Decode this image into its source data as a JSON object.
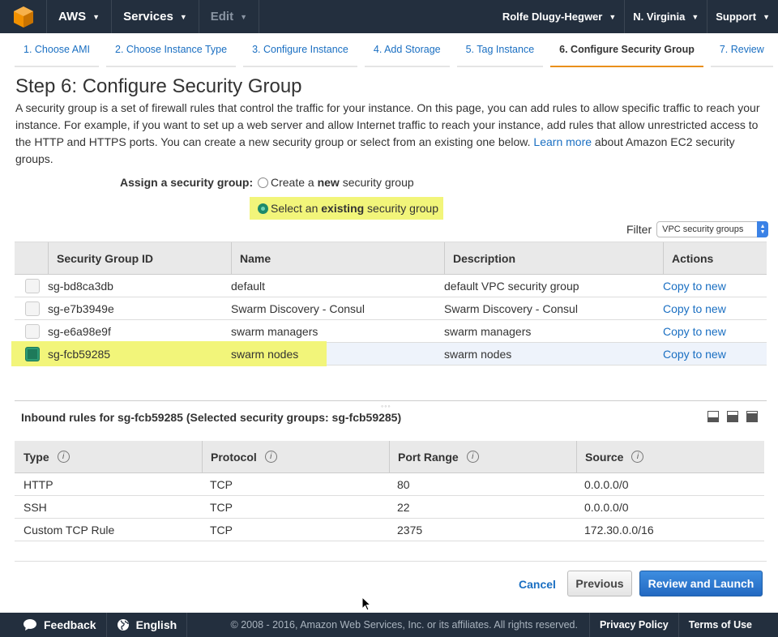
{
  "topnav": {
    "logo_icon": "aws-cube-icon",
    "aws_label": "AWS",
    "services_label": "Services",
    "edit_label": "Edit",
    "user_label": "Rolfe Dlugy-Hegwer",
    "region_label": "N. Virginia",
    "support_label": "Support"
  },
  "wizard": {
    "steps": [
      {
        "label": "1. Choose AMI"
      },
      {
        "label": "2. Choose Instance Type"
      },
      {
        "label": "3. Configure Instance"
      },
      {
        "label": "4. Add Storage"
      },
      {
        "label": "5. Tag Instance"
      },
      {
        "label": "6. Configure Security Group"
      },
      {
        "label": "7. Review"
      }
    ],
    "active_index": 5
  },
  "page": {
    "title": "Step 6: Configure Security Group",
    "intro_text": "A security group is a set of firewall rules that control the traffic for your instance. On this page, you can add rules to allow specific traffic to reach your instance. For example, if you want to set up a web server and allow Internet traffic to reach your instance, add rules that allow unrestricted access to the HTTP and HTTPS ports. You can create a new security group or select from an existing one below.",
    "learn_more": "Learn more",
    "intro_suffix": "about Amazon EC2 security groups."
  },
  "assign": {
    "label": "Assign a security group:",
    "create_prefix": "Create a ",
    "create_bold": "new",
    "create_suffix": " security group",
    "select_prefix": "Select an ",
    "select_bold": "existing",
    "select_suffix": " security group",
    "selected": "existing"
  },
  "filter": {
    "label": "Filter",
    "value": "VPC security groups"
  },
  "security_groups": {
    "headers": {
      "id": "Security Group ID",
      "name": "Name",
      "description": "Description",
      "actions": "Actions"
    },
    "rows": [
      {
        "id": "sg-bd8ca3db",
        "name": "default",
        "description": "default VPC security group",
        "action": "Copy to new"
      },
      {
        "id": "sg-e7b3949e",
        "name": "Swarm Discovery - Consul",
        "description": "Swarm Discovery - Consul",
        "action": "Copy to new"
      },
      {
        "id": "sg-e6a98e9f",
        "name": "swarm managers",
        "description": "swarm managers",
        "action": "Copy to new"
      },
      {
        "id": "sg-fcb59285",
        "name": "swarm nodes",
        "description": "swarm nodes",
        "action": "Copy to new"
      }
    ],
    "selected_index": 3
  },
  "inbound": {
    "title": "Inbound rules for sg-fcb59285 (Selected security groups: sg-fcb59285)",
    "headers": {
      "type": "Type",
      "protocol": "Protocol",
      "port_range": "Port Range",
      "source": "Source"
    },
    "rows": [
      {
        "type": "HTTP",
        "protocol": "TCP",
        "port_range": "80",
        "source": "0.0.0.0/0"
      },
      {
        "type": "SSH",
        "protocol": "TCP",
        "port_range": "22",
        "source": "0.0.0.0/0"
      },
      {
        "type": "Custom TCP Rule",
        "protocol": "TCP",
        "port_range": "2375",
        "source": "172.30.0.0/16"
      }
    ]
  },
  "actions": {
    "cancel": "Cancel",
    "previous": "Previous",
    "review_launch": "Review and Launch"
  },
  "footer": {
    "feedback": "Feedback",
    "language": "English",
    "copyright": "© 2008 - 2016, Amazon Web Services, Inc. or its affiliates. All rights reserved.",
    "privacy": "Privacy Policy",
    "terms": "Terms of Use"
  },
  "colors": {
    "nav_bg": "#232f3e",
    "accent_orange": "#e9901b",
    "link_blue": "#1a6fc2",
    "highlight_yellow": "#f2f57a",
    "primary_button": "#2369c2"
  }
}
